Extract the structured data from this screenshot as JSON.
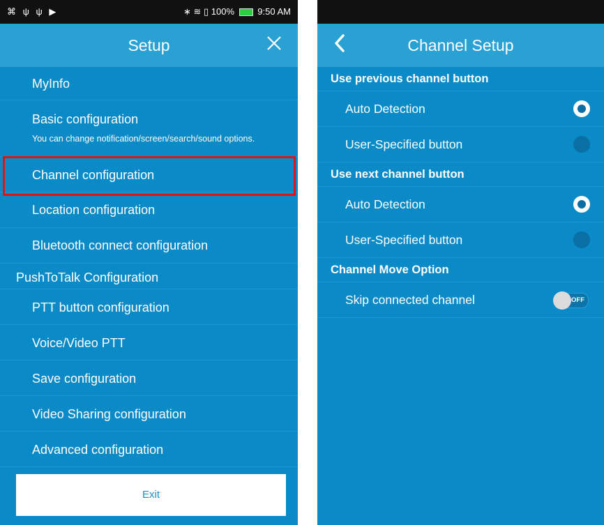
{
  "left": {
    "status": {
      "left_icons": "⌘ ψ ψ ▶",
      "right_icons": "∗ ≋ ▯",
      "battery": "100%",
      "time": "9:50 AM"
    },
    "title": "Setup",
    "menu": [
      {
        "label": "MyInfo"
      },
      {
        "label": "Basic configuration",
        "sub": "You can change notification/screen/search/sound options."
      },
      {
        "label": "Channel configuration"
      },
      {
        "label": "Location configuration"
      },
      {
        "label": "Bluetooth connect configuration"
      },
      {
        "section": "PushToTalk Configuration"
      },
      {
        "label": "PTT button configuration"
      },
      {
        "label": "Voice/Video PTT"
      },
      {
        "label": "Save configuration"
      },
      {
        "label": "Video Sharing configuration"
      },
      {
        "label": "Advanced configuration"
      }
    ],
    "exit_label": "Exit"
  },
  "right": {
    "title": "Channel Setup",
    "sections": [
      {
        "header": "Use previous channel button",
        "options": [
          {
            "label": "Auto Detection",
            "selected": true
          },
          {
            "label": "User-Specified button",
            "selected": false
          }
        ]
      },
      {
        "header": "Use next channel button",
        "options": [
          {
            "label": "Auto Detection",
            "selected": true
          },
          {
            "label": "User-Specified button",
            "selected": false
          }
        ]
      },
      {
        "header": "Channel Move Option",
        "options": [
          {
            "label": "Skip connected channel",
            "toggle": "OFF"
          }
        ]
      }
    ]
  },
  "colors": {
    "background": "#0a8bc7",
    "header": "#2aa1d3",
    "highlight": "#e01414",
    "exit_text": "#1a8fc9"
  }
}
